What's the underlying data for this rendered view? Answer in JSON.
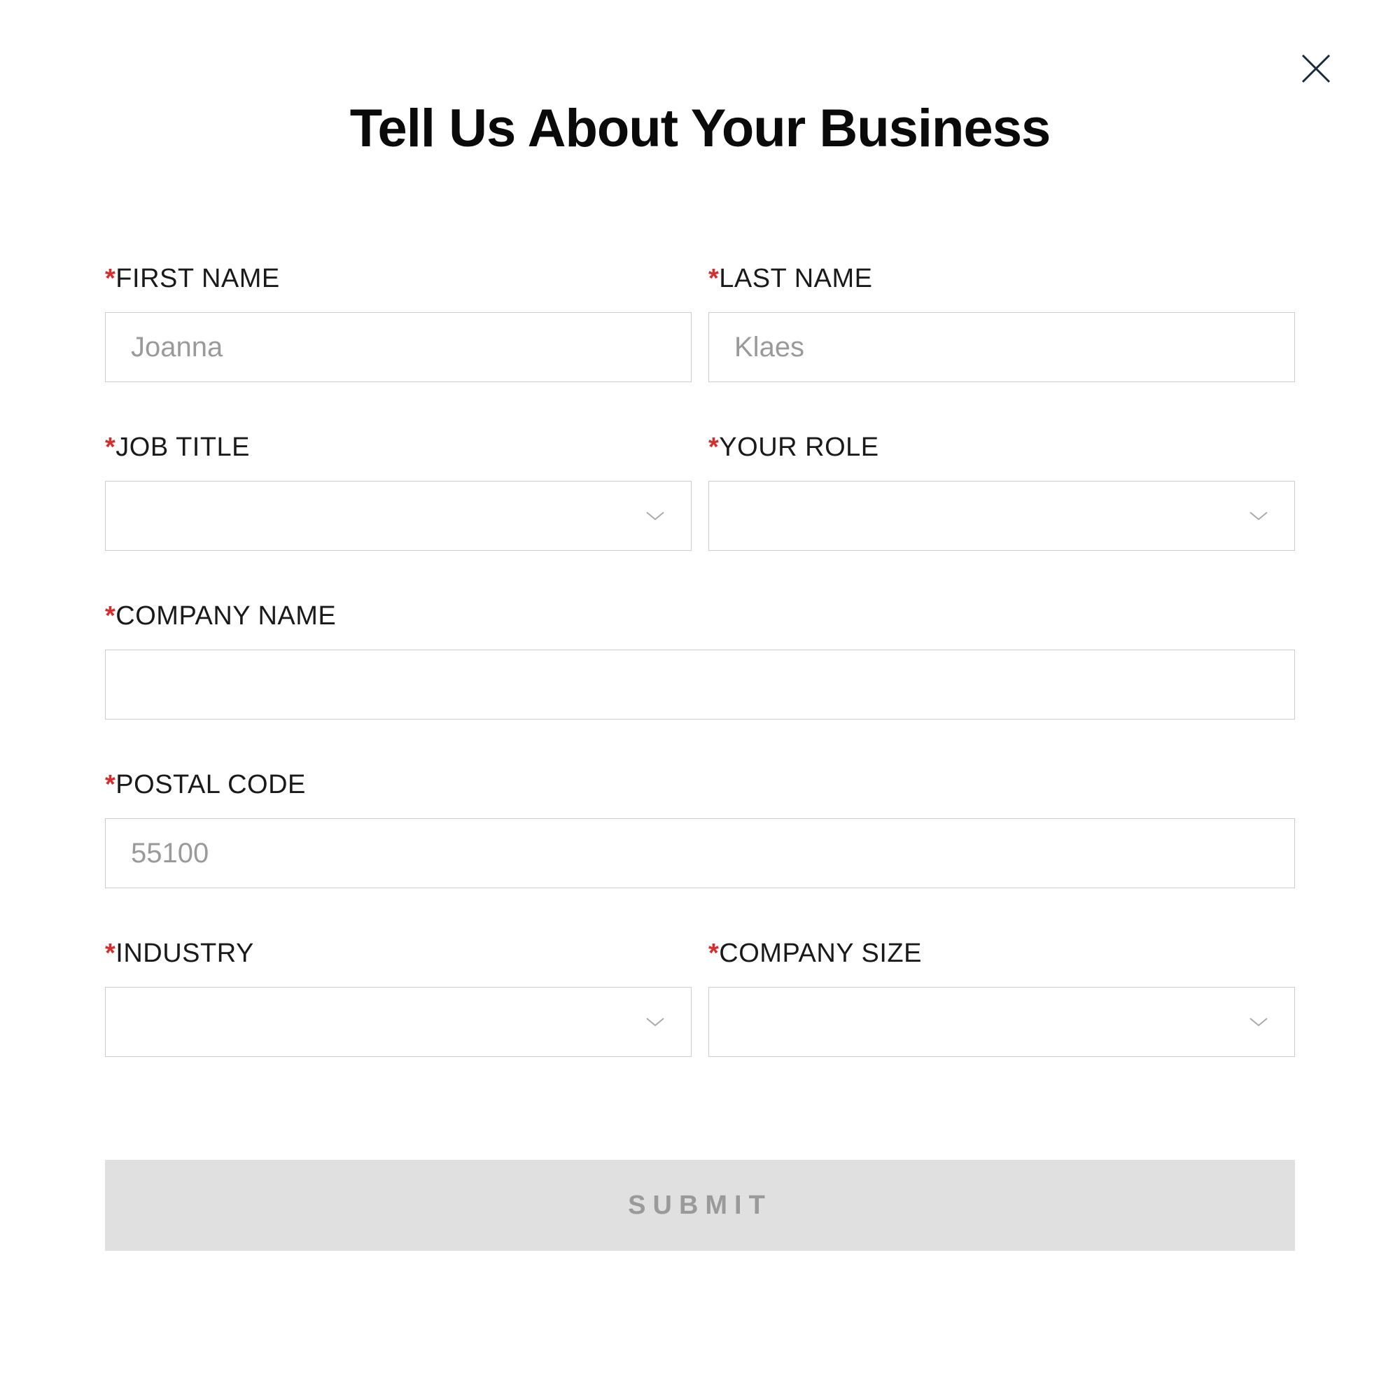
{
  "title": "Tell Us About Your Business",
  "required_marker": "*",
  "fields": {
    "first_name": {
      "label": "FIRST NAME",
      "placeholder": "Joanna",
      "value": ""
    },
    "last_name": {
      "label": "LAST NAME",
      "placeholder": "Klaes",
      "value": ""
    },
    "job_title": {
      "label": "JOB TITLE",
      "value": ""
    },
    "your_role": {
      "label": "YOUR ROLE",
      "value": ""
    },
    "company_name": {
      "label": "COMPANY NAME",
      "value": ""
    },
    "postal_code": {
      "label": "POSTAL CODE",
      "placeholder": "55100",
      "value": ""
    },
    "industry": {
      "label": "INDUSTRY",
      "value": ""
    },
    "company_size": {
      "label": "COMPANY SIZE",
      "value": ""
    }
  },
  "submit_label": "SUBMIT"
}
